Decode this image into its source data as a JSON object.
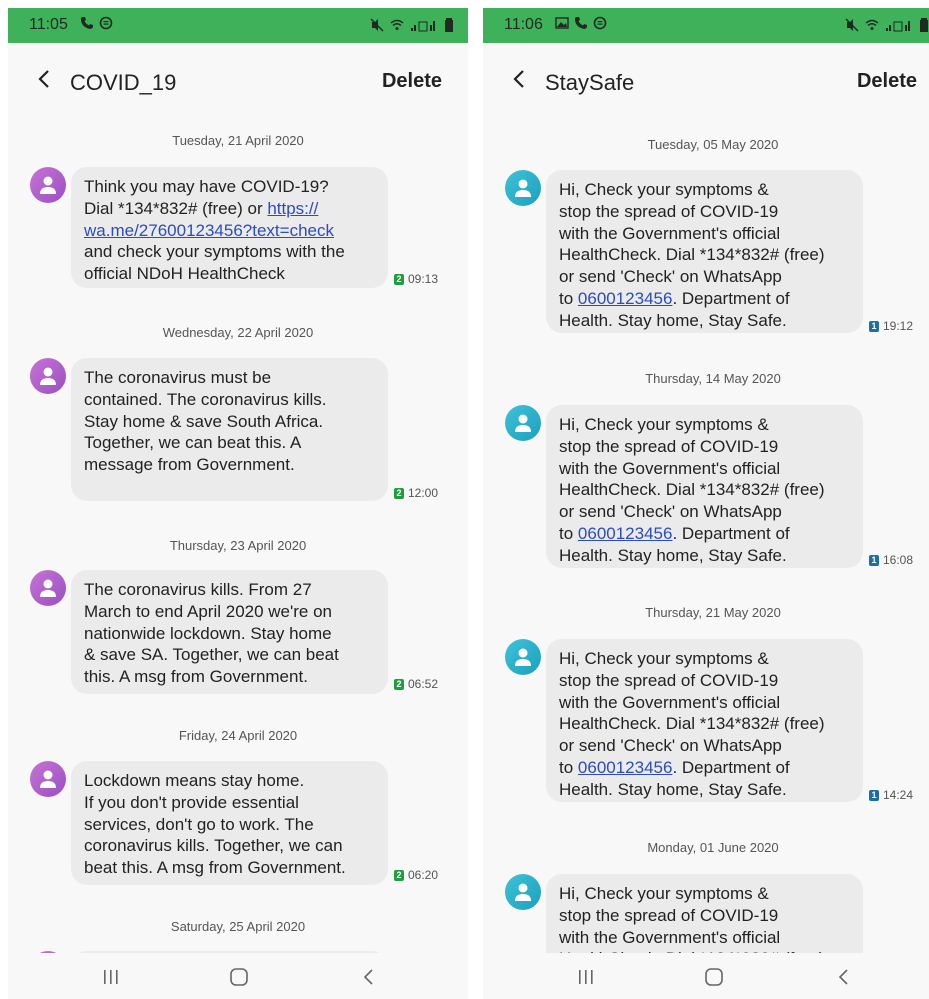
{
  "left": {
    "status": {
      "time": "11:05"
    },
    "header": {
      "title": "COVID_19",
      "delete_label": "Delete"
    },
    "messages": [
      {
        "date": "Tuesday, 21 April 2020",
        "lines_before": [
          "Think you may have COVID-19?",
          "Dial *134*832# (free) or "
        ],
        "link1": "https://",
        "link2": "wa.me/27600123456?text=check",
        "lines_after": [
          "and check your symptoms with the",
          "official NDoH HealthCheck"
        ],
        "sim": "2",
        "time": "09:13"
      },
      {
        "date": "Wednesday, 22 April 2020",
        "text_lines": [
          "The coronavirus must be",
          "contained. The coronavirus kills.",
          "Stay home & save South Africa.",
          "Together, we can beat this. A",
          "message from Government."
        ],
        "sim": "2",
        "time": "12:00"
      },
      {
        "date": "Thursday, 23 April 2020",
        "text_lines": [
          "The coronavirus kills. From 27",
          "March to end April 2020 we're on",
          "nationwide lockdown. Stay home",
          "& save SA. Together, we can beat",
          "this. A msg from Government."
        ],
        "sim": "2",
        "time": "06:52"
      },
      {
        "date": "Friday, 24 April 2020",
        "text_lines": [
          "Lockdown means stay home.",
          "If you don't provide essential",
          "services, don't go to work. The",
          "coronavirus kills. Together, we can",
          "beat this. A msg from Government."
        ],
        "sim": "2",
        "time": "06:20"
      },
      {
        "date": "Saturday, 25 April 2020"
      }
    ]
  },
  "right": {
    "status": {
      "time": "11:06"
    },
    "header": {
      "title": "StaySafe",
      "delete_label": "Delete"
    },
    "message_lines_before": [
      "Hi, Check your symptoms &",
      "stop the spread of COVID-19",
      "with the Government's official",
      "HealthCheck. Dial *134*832# (free)",
      "or send 'Check' on WhatsApp",
      "to "
    ],
    "message_link": "0600123456",
    "message_after_link": ". Department of",
    "message_last_line": "Health. Stay home, Stay Safe.",
    "messages": [
      {
        "date": "Tuesday, 05 May 2020",
        "sim": "1",
        "time": "19:12"
      },
      {
        "date": "Thursday, 14 May 2020",
        "sim": "1",
        "time": "16:08"
      },
      {
        "date": "Thursday, 21 May 2020",
        "sim": "1",
        "time": "14:24"
      },
      {
        "date": "Monday, 01 June 2020"
      }
    ]
  },
  "colors": {
    "status_bar": "#3fb15a",
    "bubble": "#ebebeb",
    "link": "#2b4bc4",
    "sim_green": "#1e9e3e",
    "sim_blue": "#1a6fa8"
  },
  "icons": [
    "back-arrow-icon",
    "contact-avatar-icon",
    "call-icon",
    "notification-icon",
    "mute-icon",
    "wifi-icon",
    "signal-icon",
    "battery-icon",
    "gallery-icon",
    "recents-icon",
    "home-icon",
    "nav-back-icon"
  ]
}
